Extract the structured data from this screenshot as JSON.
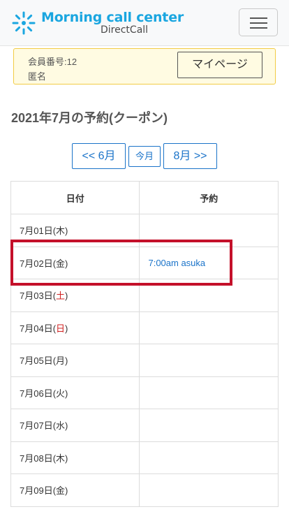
{
  "header": {
    "logo_title": "Morning call center",
    "logo_subtitle": "DirectCall",
    "menu_icon": "hamburger-icon"
  },
  "member": {
    "number_line": "会員番号:12",
    "name_line": "匿名",
    "mypage_label": "マイページ"
  },
  "page_title": "2021年7月の予約(クーポン)",
  "month_nav": {
    "prev_label": "<< 6月",
    "current_label": "今月",
    "next_label": "8月 >>"
  },
  "table": {
    "headers": [
      "日付",
      "予約"
    ],
    "rows": [
      {
        "date_prefix": "7月01日(",
        "weekday": "木",
        "date_suffix": ")",
        "reservation": ""
      },
      {
        "date_prefix": "7月02日(",
        "weekday": "金",
        "date_suffix": ")",
        "reservation": "7:00am asuka"
      },
      {
        "date_prefix": "7月03日(",
        "weekday": "土",
        "date_suffix": ")",
        "reservation": ""
      },
      {
        "date_prefix": "7月04日(",
        "weekday": "日",
        "date_suffix": ")",
        "reservation": ""
      },
      {
        "date_prefix": "7月05日(",
        "weekday": "月",
        "date_suffix": ")",
        "reservation": ""
      },
      {
        "date_prefix": "7月06日(",
        "weekday": "火",
        "date_suffix": ")",
        "reservation": ""
      },
      {
        "date_prefix": "7月07日(",
        "weekday": "水",
        "date_suffix": ")",
        "reservation": ""
      },
      {
        "date_prefix": "7月08日(",
        "weekday": "木",
        "date_suffix": ")",
        "reservation": ""
      },
      {
        "date_prefix": "7月09日(",
        "weekday": "金",
        "date_suffix": ")",
        "reservation": ""
      }
    ]
  },
  "colors": {
    "brand": "#1aa6e0",
    "link": "#1a73c9",
    "weekend": "#d02020",
    "highlight": "#c4102a",
    "member_bg": "#fffbe2",
    "member_border": "#f2cc45"
  }
}
